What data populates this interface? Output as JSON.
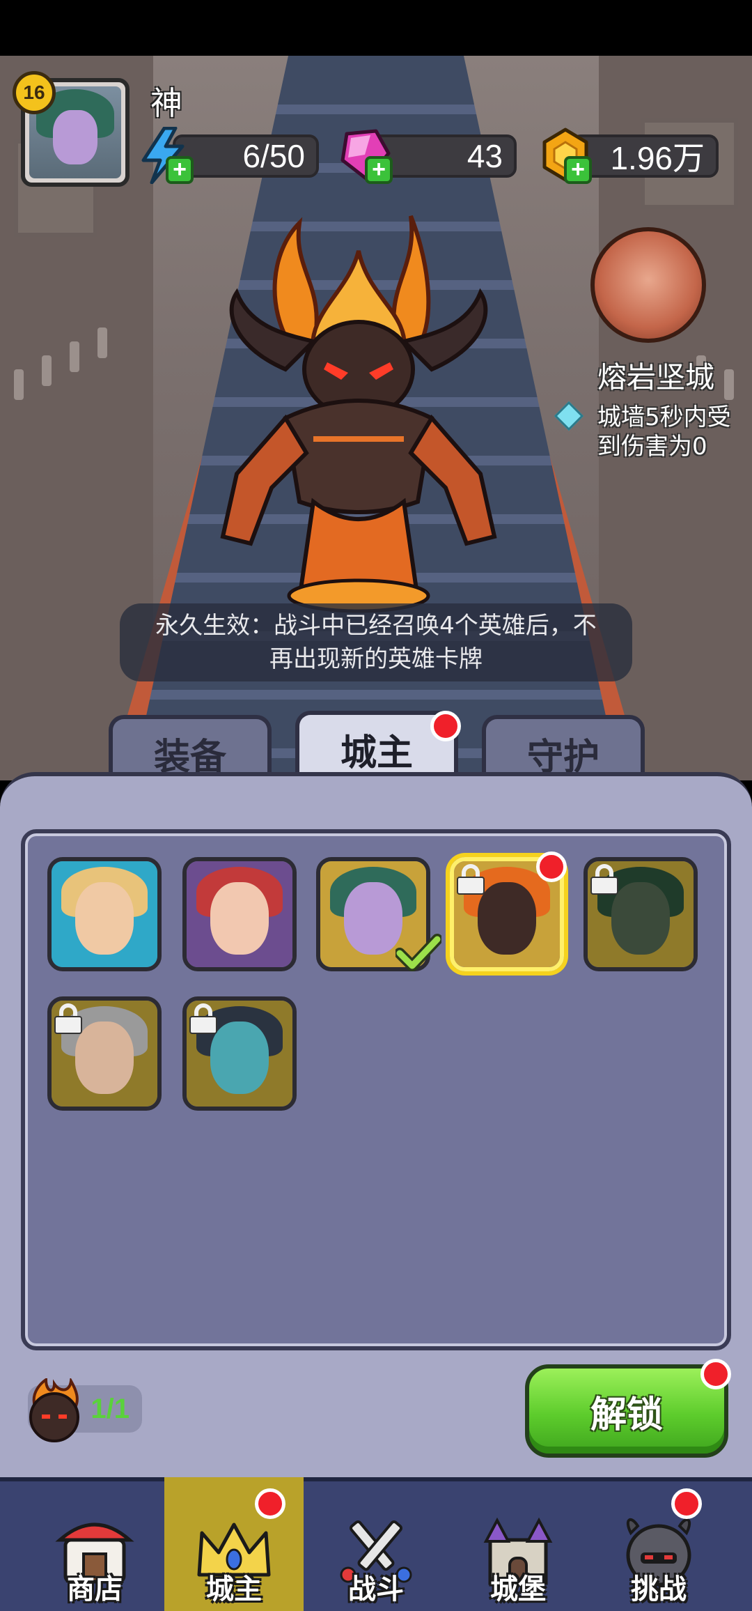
{
  "player": {
    "level": "16",
    "name": "神"
  },
  "resources": {
    "energy": "6/50",
    "gems": "43",
    "gold": "1.96万"
  },
  "hero_detail": {
    "skill_name": "熔岩坚城",
    "skill_desc": "城墙5秒内受到伤害为0",
    "effect_text": "永久生效：战斗中已经召唤4个英雄后，不再出现新的英雄卡牌"
  },
  "tabs": [
    {
      "label": "装备",
      "active": false
    },
    {
      "label": "城主",
      "active": true,
      "notify": true
    },
    {
      "label": "守护",
      "active": false
    }
  ],
  "heroes": [
    {
      "name": "blonde-elf-hero",
      "locked": false,
      "owned": true
    },
    {
      "name": "red-haired-sorceress-hero",
      "locked": false,
      "owned": true
    },
    {
      "name": "green-haired-elf-hero",
      "locked": false,
      "owned": true,
      "equipped": true
    },
    {
      "name": "lava-golem-hero",
      "locked": true,
      "selected": true,
      "notify": true
    },
    {
      "name": "demon-hunter-hero",
      "locked": true
    },
    {
      "name": "grey-bearded-warrior-hero",
      "locked": true
    },
    {
      "name": "skeleton-king-hero",
      "locked": true
    }
  ],
  "unlock": {
    "count": "1/1",
    "button_label": "解锁"
  },
  "nav": [
    {
      "label": "商店",
      "icon": "shop-icon",
      "active": false
    },
    {
      "label": "城主",
      "icon": "crown-icon",
      "active": true,
      "notify": true
    },
    {
      "label": "战斗",
      "icon": "crossed-swords-icon",
      "active": false
    },
    {
      "label": "城堡",
      "icon": "castle-icon",
      "active": false
    },
    {
      "label": "挑战",
      "icon": "demon-helmet-icon",
      "active": false,
      "notify": true
    }
  ],
  "colors": {
    "accent_green": "#5dcc2c",
    "notify_red": "#f0202a",
    "nav_active": "#b9a22a",
    "panel": "#a8a9c6"
  }
}
